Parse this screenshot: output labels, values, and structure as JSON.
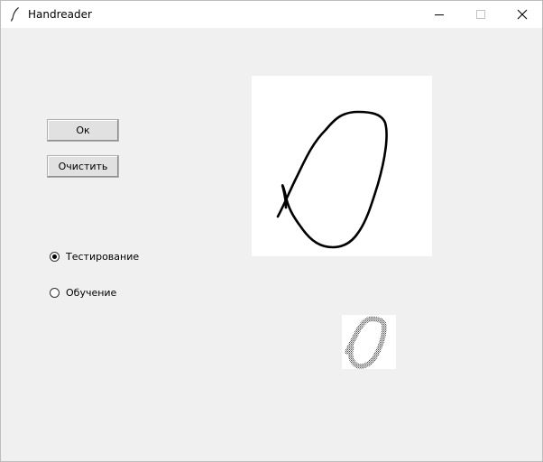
{
  "window": {
    "title": "Handreader",
    "app_icon": "feather-icon",
    "controls": [
      "minimize-icon",
      "maximize-icon",
      "close-icon"
    ]
  },
  "buttons": {
    "ok_label": "Ок",
    "clear_label": "Очистить"
  },
  "mode": {
    "options": [
      {
        "label": "Тестирование",
        "selected": true
      },
      {
        "label": "Обучение",
        "selected": false
      }
    ]
  }
}
